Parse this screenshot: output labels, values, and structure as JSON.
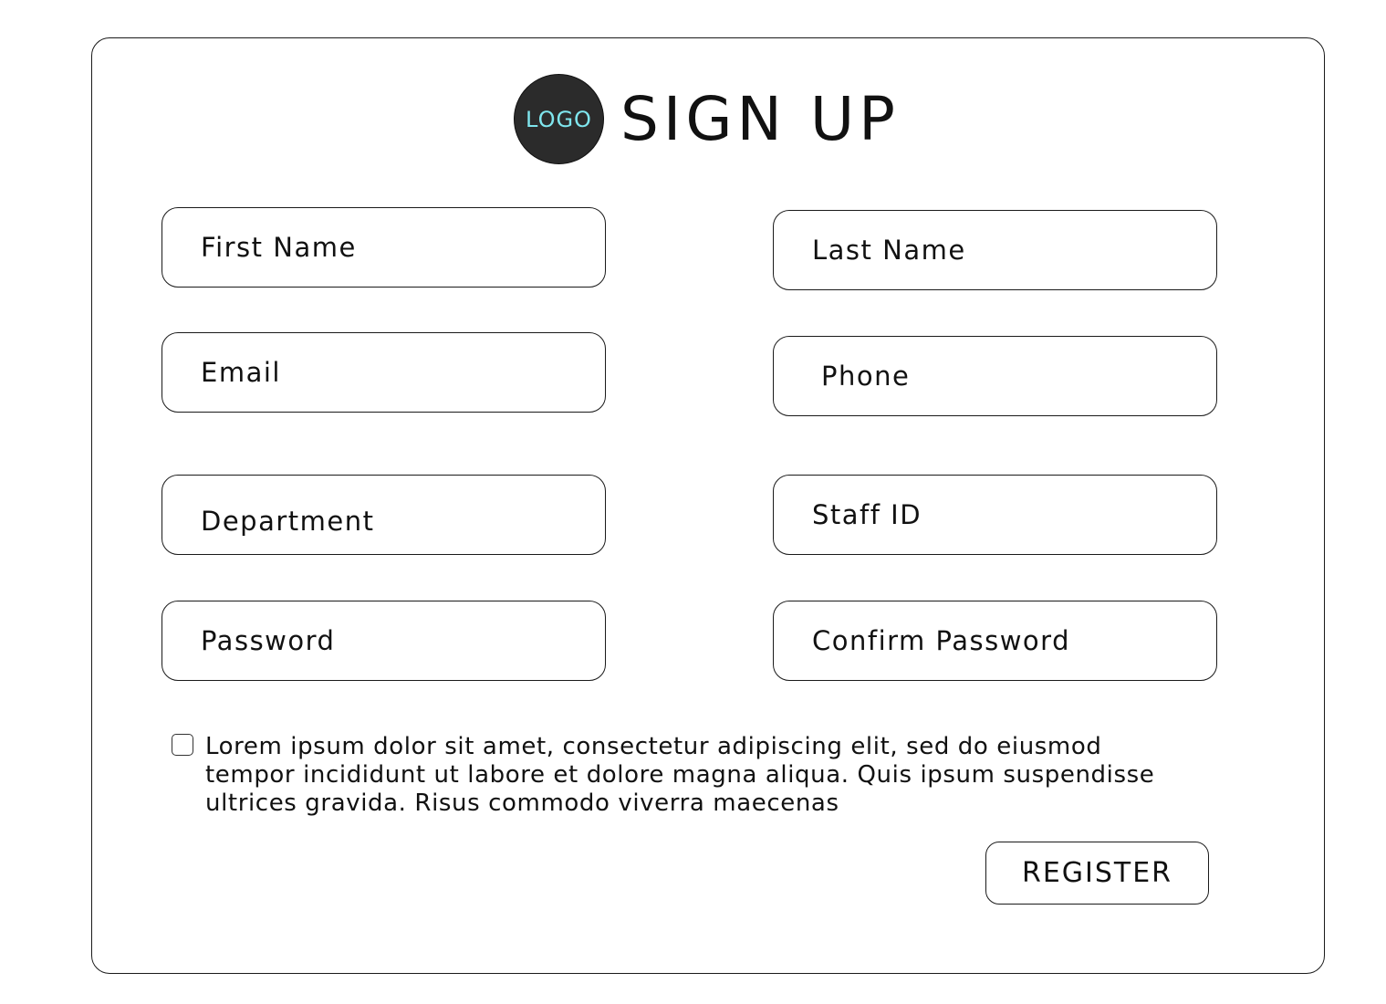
{
  "header": {
    "logo_text": "LOGO",
    "title": "SIGN UP",
    "logo_text_color": "#7fe6ee",
    "logo_bg_color": "#2b2b2b"
  },
  "form": {
    "first_name": {
      "placeholder": "First Name",
      "value": ""
    },
    "last_name": {
      "placeholder": "Last Name",
      "value": ""
    },
    "email": {
      "placeholder": "Email",
      "value": ""
    },
    "phone": {
      "placeholder": "Phone",
      "value": ""
    },
    "department": {
      "placeholder": "Department",
      "value": ""
    },
    "staff_id": {
      "placeholder": "Staff ID",
      "value": ""
    },
    "password": {
      "placeholder": "Password",
      "value": ""
    },
    "confirm_password": {
      "placeholder": "Confirm Password",
      "value": ""
    }
  },
  "terms": {
    "checked": false,
    "text": "Lorem ipsum dolor sit amet, consectetur adipiscing elit, sed do eiusmod tempor incididunt ut labore et dolore magna aliqua. Quis ipsum suspendisse ultrices gravida. Risus commodo viverra maecenas"
  },
  "actions": {
    "register_label": "REGISTER"
  }
}
